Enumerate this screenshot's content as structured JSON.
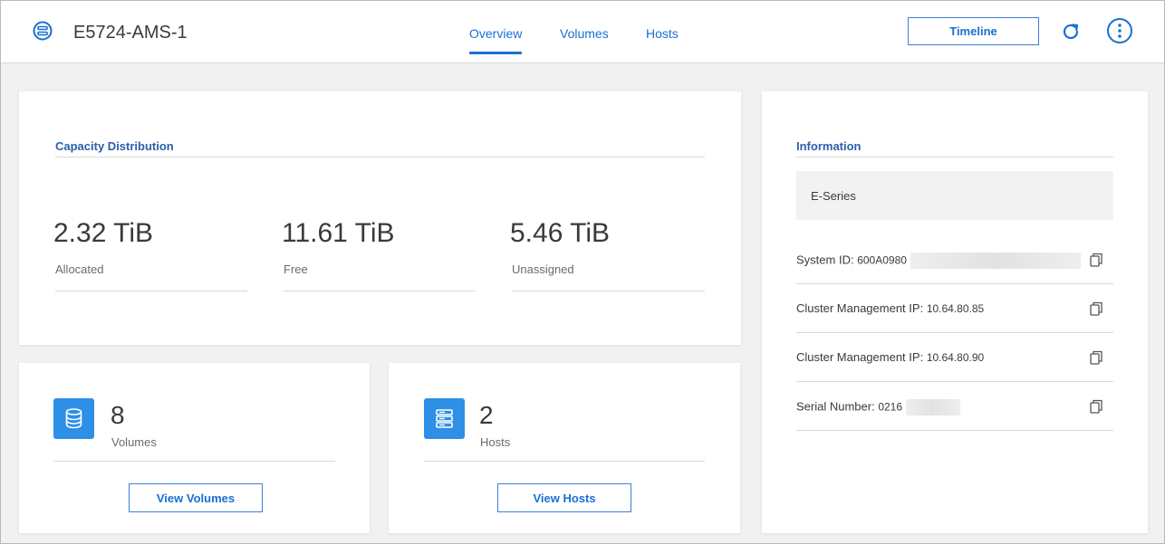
{
  "header": {
    "system_name": "E5724-AMS-1",
    "tabs": [
      {
        "label": "Overview",
        "active": true
      },
      {
        "label": "Volumes",
        "active": false
      },
      {
        "label": "Hosts",
        "active": false
      }
    ],
    "timeline_label": "Timeline",
    "icons": {
      "system": "storage-system-icon",
      "refresh": "refresh-icon",
      "more": "more-options-icon"
    },
    "accent_color": "#1a6fd1"
  },
  "capacity": {
    "title": "Capacity Distribution",
    "items": [
      {
        "value": "2.32 TiB",
        "label": "Allocated"
      },
      {
        "value": "11.61 TiB",
        "label": "Free"
      },
      {
        "value": "5.46 TiB",
        "label": "Unassigned"
      }
    ]
  },
  "volumes": {
    "count": "8",
    "label": "Volumes",
    "button": "View Volumes",
    "icon": "database-icon"
  },
  "hosts": {
    "count": "2",
    "label": "Hosts",
    "button": "View Hosts",
    "icon": "server-icon"
  },
  "information": {
    "title": "Information",
    "type": "E-Series",
    "rows": [
      {
        "label": "System ID:",
        "value": "600A0980",
        "redacted": true
      },
      {
        "label": "Cluster Management IP:",
        "value": "10.64.80.85",
        "redacted": false
      },
      {
        "label": "Cluster Management IP:",
        "value": "10.64.80.90",
        "redacted": false
      },
      {
        "label": "Serial Number:",
        "value": "0216",
        "redacted": true
      }
    ]
  },
  "colors": {
    "tile_icon_bg": "#2e8fe6",
    "title_blue": "#2b5fa8"
  }
}
